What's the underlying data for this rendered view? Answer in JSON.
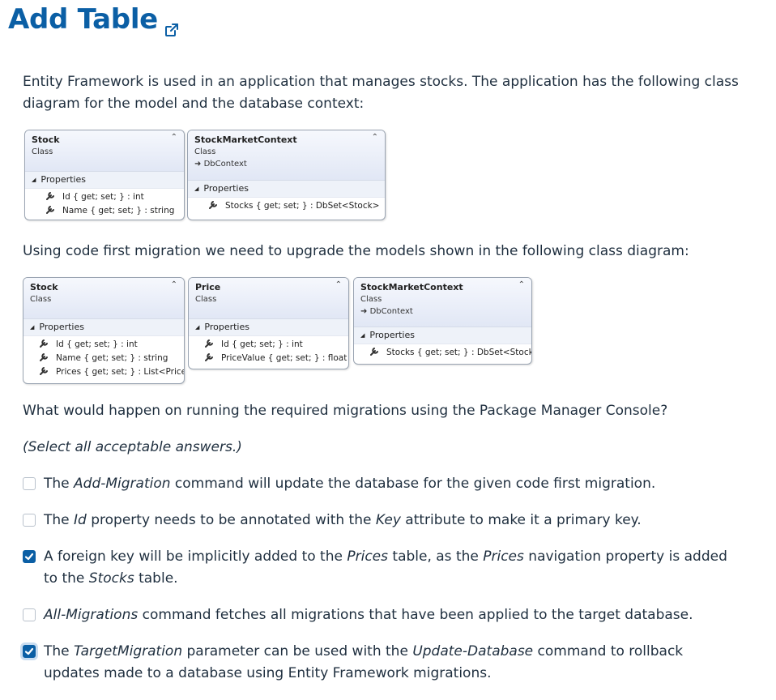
{
  "page": {
    "title": "Add Table",
    "intro_1": "Entity Framework is used in an application that manages stocks. The application has the following class diagram for the model and the database context:",
    "intro_2": "Using code first migration we need to upgrade the models shown in the following class diagram:",
    "question": "What would happen on running the required migrations using the Package Manager Console?",
    "instruction": "(Select all acceptable answers.)"
  },
  "diagram1": {
    "stock": {
      "name": "Stock",
      "type": "Class",
      "section": "Properties",
      "props": [
        "Id { get; set; } : int",
        "Name { get; set; } : string"
      ]
    },
    "context": {
      "name": "StockMarketContext",
      "type": "Class",
      "base": "DbContext",
      "section": "Properties",
      "props": [
        "Stocks { get; set; } : DbSet<Stock>"
      ]
    }
  },
  "diagram2": {
    "stock": {
      "name": "Stock",
      "type": "Class",
      "section": "Properties",
      "props": [
        "Id { get; set; } : int",
        "Name { get; set; } : string",
        "Prices { get; set; } : List<Price>"
      ]
    },
    "price": {
      "name": "Price",
      "type": "Class",
      "section": "Properties",
      "props": [
        "Id { get; set; } : int",
        "PriceValue { get; set; } : float"
      ]
    },
    "context": {
      "name": "StockMarketContext",
      "type": "Class",
      "base": "DbContext",
      "section": "Properties",
      "props": [
        "Stocks { get; set; } : DbSet<Stock>"
      ]
    }
  },
  "options": [
    {
      "checked": false,
      "parts": [
        "The ",
        "Add-Migration",
        " command will update the database for the given code first migration."
      ]
    },
    {
      "checked": false,
      "parts": [
        "The ",
        "Id",
        " property needs to be annotated with the ",
        "Key",
        " attribute to make it a primary key."
      ]
    },
    {
      "checked": true,
      "parts": [
        "A foreign key will be implicitly added to the ",
        "Prices",
        " table, as the ",
        "Prices",
        " navigation property is added to the ",
        "Stocks",
        " table."
      ]
    },
    {
      "checked": false,
      "parts": [
        "",
        "All-Migrations",
        " command fetches all migrations that have been applied to the target database."
      ]
    },
    {
      "checked": true,
      "parts": [
        "The ",
        "TargetMigration",
        " parameter can be used with the ",
        "Update-Database",
        " command to rollback updates made to a database using Entity Framework migrations."
      ]
    }
  ],
  "icons": {
    "title_link": "external-link-icon",
    "property": "wrench-icon",
    "collapse": "double-chevron-up-icon",
    "base_class": "inheritance-arrow-icon",
    "checkbox": "checkmark-icon"
  },
  "colors": {
    "title": "#0b5fa5",
    "checkbox_checked": "#0b5fa5",
    "text": "#1f2f3f"
  }
}
